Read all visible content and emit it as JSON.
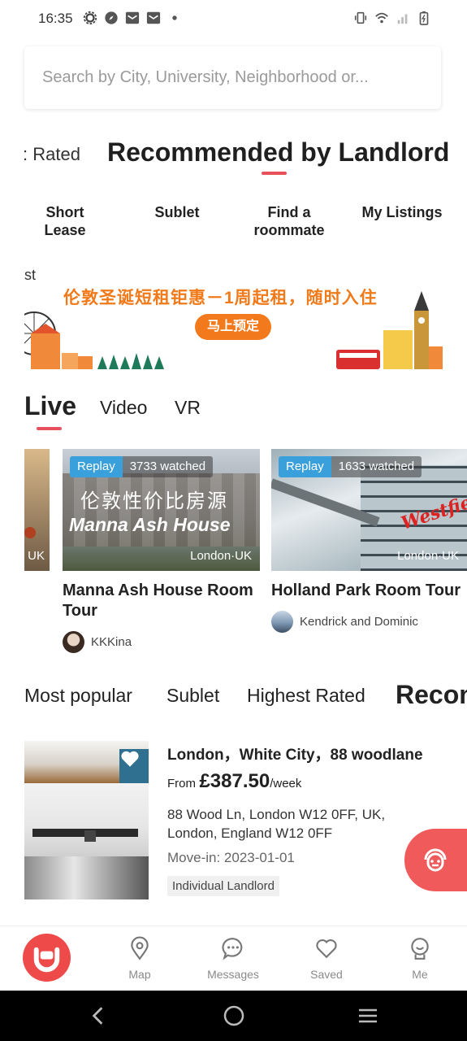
{
  "status_bar": {
    "time": "16:35"
  },
  "search": {
    "placeholder": "Search by City, University, Neighborhood or..."
  },
  "category_tabs": {
    "prev_partial": ": Rated",
    "active": "Recommended by Landlord"
  },
  "quick_links": [
    {
      "label": "Short\nLease"
    },
    {
      "label": "Sublet"
    },
    {
      "label": "Find a\nroommate"
    },
    {
      "label": "My Listings"
    }
  ],
  "banner": {
    "headline": "伦敦圣诞短租钜惠－1周起租，随时入住",
    "cta": "马上预定",
    "corner_text": "st"
  },
  "media_tabs": {
    "live": "Live",
    "video": "Video",
    "vr": "VR"
  },
  "live_cards": [
    {
      "badge": "Replay",
      "watched": "3733 watched",
      "overlay_cn": "伦敦性价比房源",
      "overlay_en": "Manna Ash House",
      "location": "London·UK",
      "title": "Manna Ash House Room Tour",
      "author": "KKKina"
    },
    {
      "badge": "Replay",
      "watched": "1633 watched",
      "overlay_brand": "Westfield",
      "location": "London·UK",
      "title": "Holland Park Room Tour",
      "author": "Kendrick and Dominic"
    }
  ],
  "partial_card": {
    "location": "UK"
  },
  "list_tabs": {
    "popular": "Most popular",
    "sublet": "Sublet",
    "rated": "Highest Rated",
    "active": "Recom"
  },
  "listing": {
    "title": "London，White City，88 woodlane",
    "price_from": "From",
    "price": "£387.50",
    "price_unit": "/week",
    "address": "88 Wood Ln, London W12 0FF, UK, London, England W12 0FF",
    "move_in": "Move-in: 2023-01-01",
    "tag": "Individual Landlord"
  },
  "bottom_nav": {
    "map": "Map",
    "messages": "Messages",
    "saved": "Saved",
    "me": "Me"
  },
  "colors": {
    "accent": "#e8505b",
    "replay_blue": "#3aa0dc",
    "brand_red": "#ef4a4a"
  }
}
